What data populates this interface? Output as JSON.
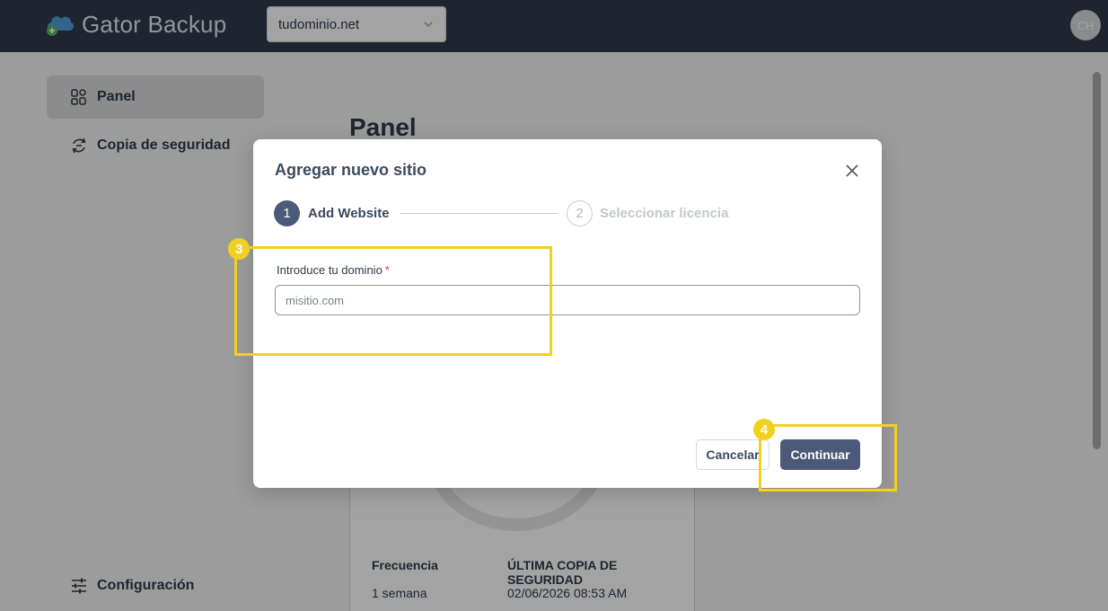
{
  "header": {
    "brand": "Gator Backup",
    "domain_select": {
      "value": "tudominio.net"
    },
    "avatar_initials": "CH"
  },
  "sidebar": {
    "items": [
      {
        "label": "Panel",
        "icon": "dashboard-icon",
        "active": true
      },
      {
        "label": "Copia de seguridad",
        "icon": "backup-icon",
        "active": false
      }
    ],
    "bottom": {
      "label": "Configuración",
      "icon": "sliders-icon"
    }
  },
  "main": {
    "title": "Panel",
    "card": {
      "columns": [
        {
          "header": "Frecuencia",
          "value": "1 semana"
        },
        {
          "header": "ÚLTIMA COPIA DE SEGURIDAD",
          "value": "02/06/2026 08:53 AM"
        }
      ]
    }
  },
  "modal": {
    "title": "Agregar nuevo sitio",
    "steps": [
      {
        "number": "1",
        "label": "Add Website",
        "state": "active"
      },
      {
        "number": "2",
        "label": "Seleccionar licencia",
        "state": "inactive"
      }
    ],
    "field": {
      "label": "Introduce tu dominio",
      "required_mark": "*",
      "placeholder": "misitio.com",
      "value": ""
    },
    "buttons": {
      "cancel": "Cancelar",
      "continue": "Continuar"
    }
  },
  "callouts": [
    {
      "number": "3",
      "target": "domain-field"
    },
    {
      "number": "4",
      "target": "continue-button"
    }
  ],
  "colors": {
    "header_bg": "#2f3a4c",
    "primary": "#4a5a78",
    "highlight": "#f2d020",
    "required": "#e0413a"
  }
}
